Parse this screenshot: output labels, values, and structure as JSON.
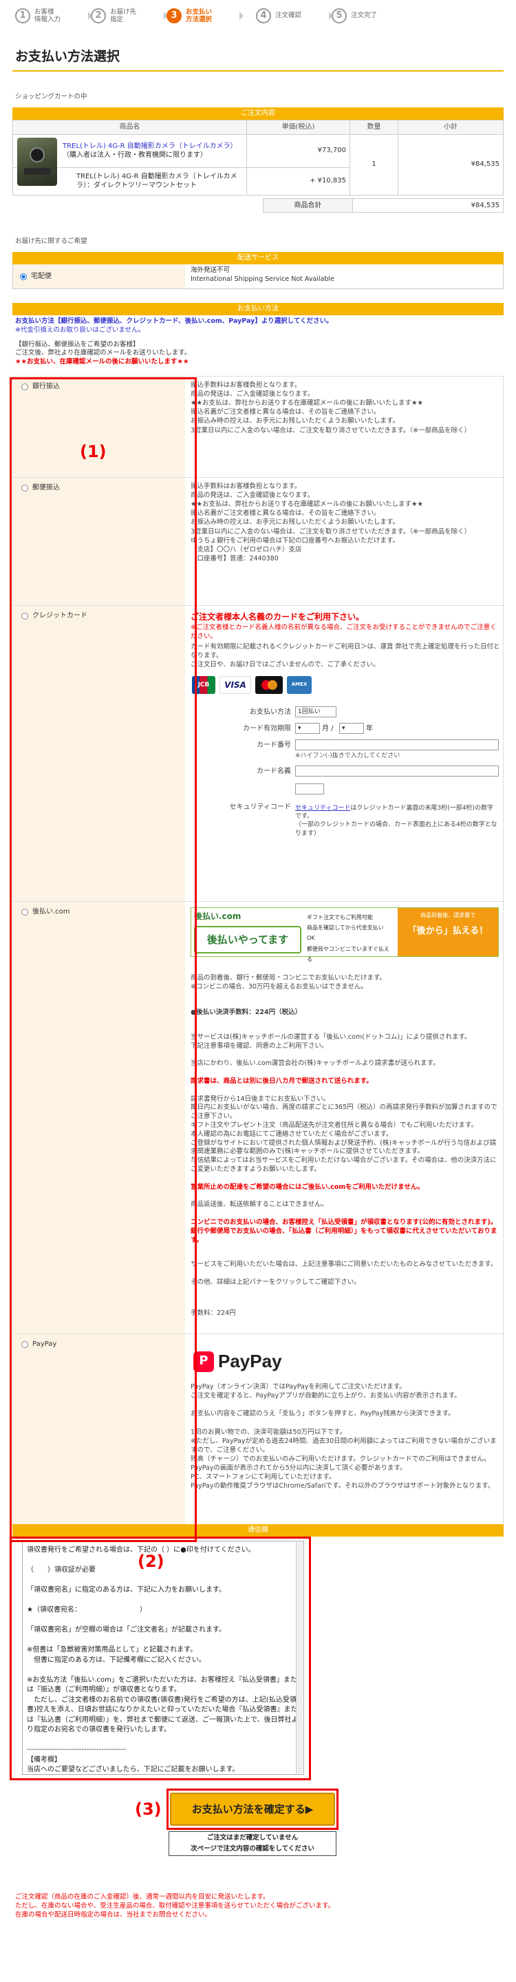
{
  "steps": [
    {
      "num": "1",
      "label": "お客様\n情報入力",
      "active": false
    },
    {
      "num": "2",
      "label": "お届け先\n指定",
      "active": false
    },
    {
      "num": "3",
      "label": "お支払い\n方法選択",
      "active": true
    },
    {
      "num": "4",
      "label": "注文確認",
      "active": false
    },
    {
      "num": "5",
      "label": "注文完了",
      "active": false
    }
  ],
  "page_title": "お支払い方法選択",
  "cart_caption": "ショッピングカートの中",
  "order_header": "ご注文内容",
  "order_table": {
    "columns": [
      "商品名",
      "単価(税込)",
      "数量",
      "小計"
    ],
    "item_name": "TREL(トレル) 4G-R 自動撮影カメラ（トレイルカメラ）",
    "item_note": "（購入者は法人・行政・教育機関に限ります）",
    "item_price": "¥73,700",
    "option_name": "TREL(トレル) 4G-R 自動撮影カメラ（トレイルカメラ）：ダイレクトツリーマウントセット",
    "option_price": "+ ¥10,835",
    "qty": "1",
    "subtotal": "¥84,535",
    "total_label": "商品合計",
    "total_value": "¥84,535"
  },
  "delivery_caption": "お届け先に関するご希望",
  "delivery_header": "配送サービス",
  "delivery_option": "宅配便",
  "delivery_note": "海外発送不可\nInternational Shipping Service Not Available",
  "payment_header": "お支払い方法",
  "payment_intro_1": "お支払い方法【銀行振込、郵便振込、クレジットカード、後払い.com、PayPay】より選択してください。",
  "payment_intro_2": "※代金引換えのお取り扱いはございません。",
  "payment_intro_3": "【銀行振込、郵便振込をご希望のお客様】\nご注文後、弊社より在庫確認のメールをお送りいたします。",
  "payment_intro_4": "★★お支払い、在庫確認メールの後にお願いいたします★★",
  "methods": [
    {
      "label": "銀行振込",
      "text": "振込手数料はお客様負担となります。\n商品の発送は、ご入金確認後となります。\n★★お支払は、弊社からお送りする在庫確認メールの後にお願いいたします★★\n振込名義がご注文者様と異なる場合は、その旨をご連絡下さい。\nお振込み時の控えは、お手元にお残しいただくようお願いいたします。\n3営業日以内にご入金のない場合は、ご注文を取り消させていただきます。（※一部商品を除く）"
    },
    {
      "label": "郵便振込",
      "text": "振込手数料はお客様負担となります。\n商品の発送は、ご入金確認後となります。\n★★お支払は、弊社からお送りする在庫確認メールの後にお願いいたします★★\n振込名義がご注文者様と異なる場合は、その旨をご連絡下さい。\nお振込み時の控えは、お手元にお残しいただくようお願いいたします。\n3営業日以内にご入金のない場合は、ご注文を取り消させていただきます。（※一部商品を除く）\nゆうちょ銀行をご利用の場合は下記の口座番号へお振込いただけます。\n【支店】〇〇八（ゼロゼロハチ）支店\n【口座番号】普通：2440380"
    },
    {
      "label": "クレジットカード"
    },
    {
      "label": "後払い.com"
    },
    {
      "label": "PayPay"
    }
  ],
  "credit": {
    "warn": "ご注文者様本人名義のカードをご利用下さい。",
    "warn_sub": "※ご注文者様とカード名義人様の名前が異なる場合、ご注文をお受けすることができませんのでご注意ください。",
    "text": "カード有効期限に記載される＜クレジットカードご利用日＞は、運賃 弊社で売上確定処理を行った日付となります。\nご注文日や、お届け日ではございませんので、ご了承ください。",
    "logos": [
      "JCB",
      "VISA",
      "MC",
      "AMEX"
    ],
    "pay_count_label": "お支払い方法",
    "pay_count_value": "1回払い",
    "expiry_label": "カード有効期限",
    "expiry_month_suffix": "月 /",
    "expiry_year_suffix": "年",
    "number_label": "カード番号",
    "number_hint": "※ハイフン(-)抜きで入力してください",
    "name_label": "カード名義",
    "cvv_label": "セキュリティコード",
    "cvv_link": "セキュリティコード",
    "cvv_note": "はクレジットカード裏面の末尾3桁(一部4桁)の数字です。\n（一部のクレジットカードの場合、カード表面右上にある4桁の数字となります）"
  },
  "atobarai": {
    "banner_left": "後払いやってます",
    "banner_items": [
      "ギフト注文でもご利用可能",
      "商品を確認してから代金支払いOK",
      "郵便局やコンビニでいますぐ払える"
    ],
    "banner_right_top": "商品到着後、請求書で",
    "banner_right": "「後から」払える！",
    "text": "商品の到着後、銀行・郵便局・コンビニでお支払いいただけます。\n※コンビニの場合、30万円を超えるお支払いはできません。",
    "fee": "●後払い決済手数料：224円（税込）",
    "text2": "当サービスは(株)キャッチボールの運営する「後払い.com(ドットコム)」により提供されます。\n下記注意事項を確認、同意の上ご利用下さい。\n\n当店にかわり、後払い.com運営会社の(株)キャッチボールより請求書が送られます。",
    "red1": "請求書は、商品とは別に後日八カ月で郵送されて送られます。",
    "text3": "請求書発行から14日後までにお支払い下さい。\n期日内にお支払いがない場合、再度の請求ごとに365円（税込）の再請求発行手数料が加算されますのでご注意下さい。\nギフト注文やプレゼント注文（商品配送先が注文者住所と異なる場合）でもご利用いただけます。\n本人確認の為にお電話にてご連絡させていただく場合がございます。\nご登録がなサイトにおいて提供された個人情報および発送予約、(株)キャッチボールが行う与信および請求関連業務に必要な範囲のみで(株)キャッチボールに提供させていただきます。\n与信結果によってはお当サービスをご利用いただけない場合がございます。その場合は、他の決済方法にご変更いただきますようお願いいたします。",
    "red2": "営業所止めの配達をご希望の場合にはご後払い.comをご利用いただけません。",
    "text4": "商品返送後、転送依頼することはできません。",
    "red3": "コンビニでのお支払いの場合、お客様控え「払込受領書」が領収書となります(公的に有効とされます)。銀行や郵便局でお支払いの場合、「払込書（ご利用明細）」をもって領収書に代えさせていただいております。",
    "text5": "サービスをご利用いただいた場合は、上記注意事項にご同意いただいたものとみなさせていただきます。\n\nその他、詳細は上記バナーをクリックしてご確認下さい。",
    "fee_line": "手数料：224円"
  },
  "paypay": {
    "logo_text": "PayPay",
    "text": "PayPay（オンライン決済）ではPayPayを利用してご注文いただけます。\nご注文を確定すると、PayPayアプリが自動的に立ち上がり、お支払い内容が表示されます。\n\nお支払い内容をご確認のうえ「支払う」ボタンを押すと、PayPay残高から決済できます。\n\n1回のお買い物での、決済可能額は50万円以下です。\n※ただし、PayPayが定める過去24時間、過去30日間の利用額によってはご利用できない場合がございますので、ご注意ください。\n残高（チャージ）でのお支払いのみご利用いただけます。クレジットカードでのご利用はできません。\nPayPayの画面が表示されてから5分以内に決済して頂く必要があります。\nPC、スマートフォンにて利用していただけます。\nPayPayの動作推奨ブラウザはChrome/Safariです。それ以外のブラウザはサポート対象外となります。"
  },
  "comm_header": "通信欄",
  "notes_text": "領収書発行をご希望される場合は、下記の（ ）に●印を付けてください。\n\n（　　）領収証が必要\n\n「領収書宛名」に指定のある方は、下記に入力をお願いします。\n\n★（領収書宛名：　　　　　　　　　）\n\n「領収書宛名」が空欄の場合は「ご注文者名」が記載されます。\n\n※但書は「急獣被害対策用品として」と記載されます。\n　但書に指定のある方は、下記備考欄にご記入ください。\n\n※お支払方法「後払い.com」をご選択いただいた方は、お客様控え『払込受領書』または『振込書（ご利用明細）』が領収書となります。\n　ただし、ご注文者様のお名前での領収書(領収書)発行をご希望の方は、上記(払込受領書)控えを添え、日頃お世話になりかえたいと仰っていただいた場合『払込受領書』または『払込書（ご利用明細）』を、弊社まで郵便にて返送、ご一報頂いた上で、後日弊社より指定のお宛名での領収書を発行いたします。\n\n----------------------------------------\n【備考欄】\n当店へのご要望などございましたら、下記にご記載をお願いします。",
  "confirm_button": "お支払い方法を確定する▶",
  "confirm_note_1": "ご注文はまだ確定していません",
  "confirm_note_2": "次ページで注文内容の確認をしてください",
  "footer_note": "ご注文確認（商品の在庫のご入金確認）後、通常一週間以内を目安に発送いたします。\nただし、在庫のない場合や、受注生産品の場合、取付確認や注意事項を送らせていただく場合がございます。\n在庫の場合や配送日時指定の場合は、当社までお問合せください。",
  "annotations": [
    "(1)",
    "(2)",
    "(3)"
  ]
}
